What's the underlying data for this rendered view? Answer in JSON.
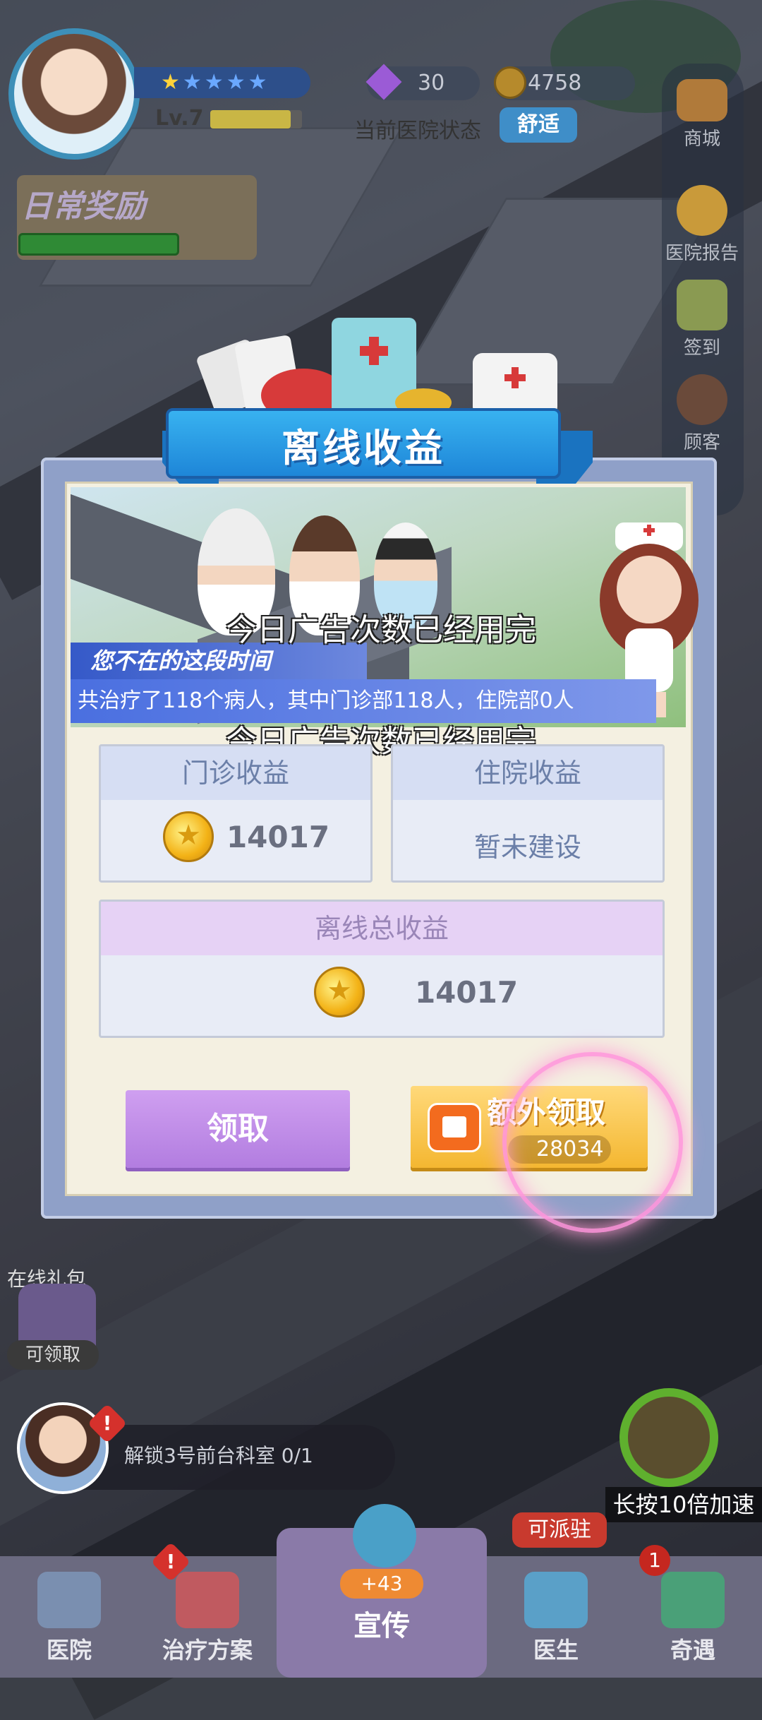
{
  "hud": {
    "stars_filled": 1,
    "stars_total": 5,
    "level": "Lv.7",
    "level_progress": 0.88,
    "gems": "30",
    "coins": "4758",
    "status_label": "当前医院状态",
    "status_value": "舒适",
    "daily_reward": "日常奖励"
  },
  "side_menu": [
    {
      "label": "商城",
      "icon": "shop-icon"
    },
    {
      "label": "医院报告",
      "icon": "report-icon"
    },
    {
      "label": "签到",
      "icon": "calendar-icon"
    },
    {
      "label": "顾客",
      "icon": "customer-icon"
    }
  ],
  "dialog": {
    "title": "离线收益",
    "absent_text": "您不在的这段时间",
    "treated_text": "共治疗了118个病人，其中门诊部118人，住院部0人",
    "ad_notice": "今日广告次数已经用完",
    "outpatient": {
      "title": "门诊收益",
      "value": "14017"
    },
    "inpatient": {
      "title": "住院收益",
      "value": "暂未建设"
    },
    "total": {
      "title": "离线总收益",
      "value": "14017"
    },
    "claim_label": "领取",
    "double_label": "额外领取",
    "double_value": "28034"
  },
  "bottom": {
    "gift_label": "在线礼包",
    "gift_status": "可领取",
    "task_text": "解锁3号前台科室  0/1",
    "speed_label": "长按10倍加速",
    "dispatch_badge": "可派驻",
    "promo_badge": "+43",
    "encounter_count": "1",
    "tabs": [
      {
        "label": "医院",
        "icon": "hospital-icon"
      },
      {
        "label": "治疗方案",
        "icon": "medkit-icon"
      },
      {
        "label": "宣传",
        "icon": "promotion-icon"
      },
      {
        "label": "医生",
        "icon": "doctor-icon"
      },
      {
        "label": "奇遇",
        "icon": "encounter-icon"
      }
    ]
  },
  "colors": {
    "banner_blue": "#1e86d8",
    "claim_purple": "#b27de0",
    "double_gold": "#f4b731"
  }
}
